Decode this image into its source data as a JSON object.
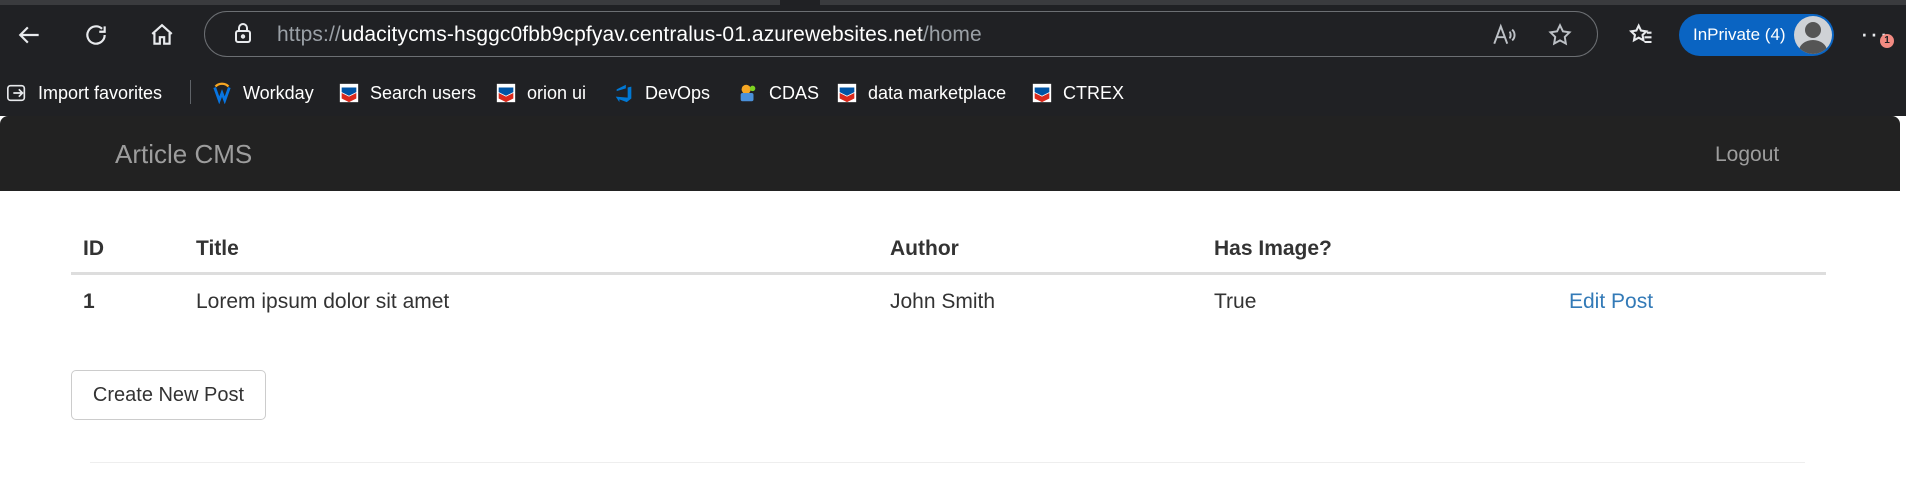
{
  "browser": {
    "url": {
      "protocol": "https://",
      "host": "udacitycms-hsggc0fbb9cpfyav.centralus-01.azurewebsites.net",
      "path": "/home"
    },
    "inprivate_label": "InPrivate (4)",
    "notification_count": "1",
    "icons": {
      "back": "back-arrow-icon",
      "refresh": "refresh-icon",
      "home": "home-icon",
      "lock": "lock-icon",
      "read_aloud": "read-aloud-icon",
      "favorite": "star-icon",
      "favorites": "favorites-icon",
      "more": "more-icon"
    },
    "bookmarks": [
      {
        "label": "Import favorites",
        "icon": "import-icon"
      },
      {
        "label": "Workday",
        "icon": "workday-icon"
      },
      {
        "label": "Search users",
        "icon": "chevron-icon"
      },
      {
        "label": "orion ui",
        "icon": "chevron-icon"
      },
      {
        "label": "DevOps",
        "icon": "devops-icon"
      },
      {
        "label": "CDAS",
        "icon": "cdas-icon"
      },
      {
        "label": "data marketplace",
        "icon": "chevron-icon"
      },
      {
        "label": "CTREX",
        "icon": "chevron-icon"
      }
    ],
    "colors": {
      "chrome_bg": "#202124",
      "inprivate_bg": "#0a64c2"
    }
  },
  "app": {
    "brand": "Article CMS",
    "logout": "Logout",
    "table": {
      "headers": [
        "ID",
        "Title",
        "Author",
        "Has Image?",
        ""
      ],
      "rows": [
        {
          "id": "1",
          "title": "Lorem ipsum dolor sit amet",
          "author": "John Smith",
          "has_image": "True",
          "action": "Edit Post"
        }
      ]
    },
    "create_button": "Create New Post",
    "colors": {
      "navbar_bg": "#222222",
      "link": "#337ab7"
    }
  }
}
